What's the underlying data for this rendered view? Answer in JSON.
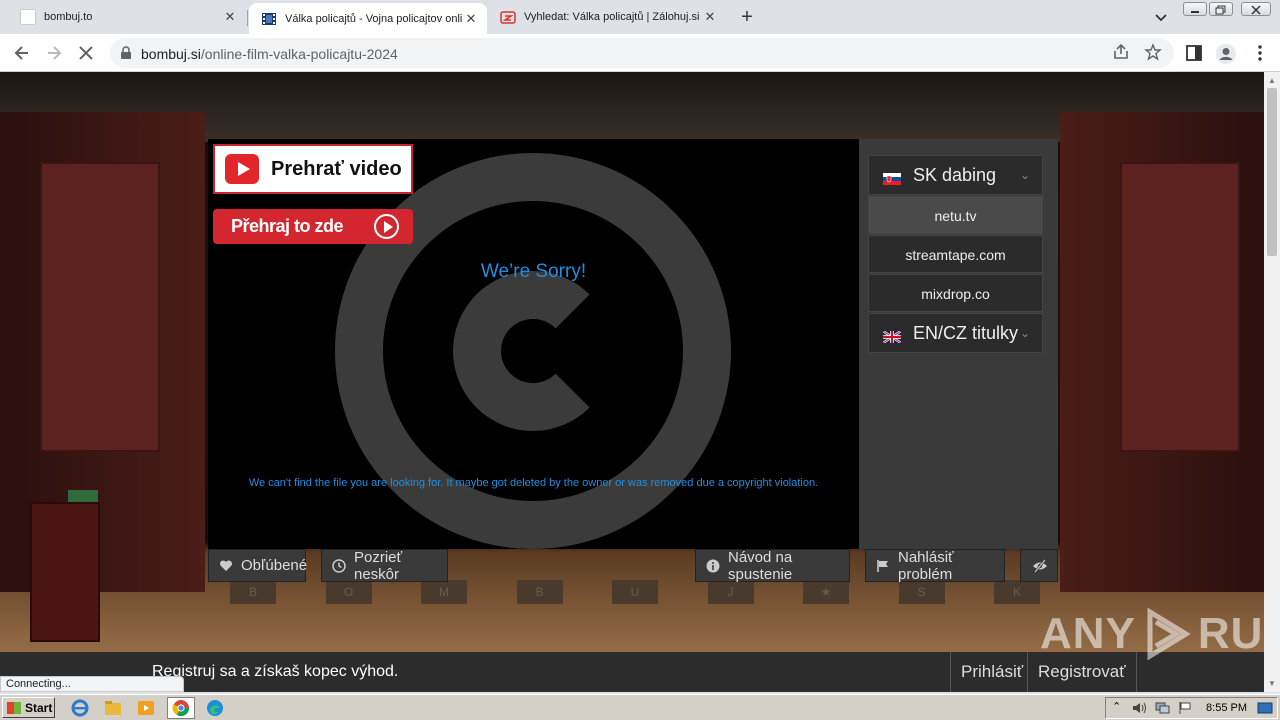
{
  "browser": {
    "tabs": [
      {
        "title": "bombuj.to",
        "active": false
      },
      {
        "title": "Válka policajtů - Vojna policajtov online",
        "active": true
      },
      {
        "title": "Vyhledat: Válka policajtů | Zálohuj.si",
        "active": false
      }
    ],
    "new_tab_label": "+",
    "url_host": "bombuj.si",
    "url_path": "/online-film-valka-policajtu-2024"
  },
  "player": {
    "play_button_label": "Prehrať video",
    "play_here_label": "Přehraj to zde",
    "sorry_title": "We’re Sorry!",
    "sorry_message": "We can't find the file you are looking for. It maybe got deleted by the owner or was removed due a copyright violation."
  },
  "sources": {
    "group_sk": "SK dabing",
    "items": [
      "netu.tv",
      "streamtape.com",
      "mixdrop.co"
    ],
    "group_en": "EN/CZ titulky"
  },
  "actions": {
    "favorite": "Obľúbené",
    "watch_later": "Pozrieť neskôr",
    "how_to_play": "Návod na spustenie",
    "report": "Nahlásiť problém"
  },
  "footer": {
    "promo": "Registruj sa a získaš kopec výhod.",
    "login": "Prihlásiť",
    "register": "Registrovať"
  },
  "stage_letters": [
    "B",
    "O",
    "M",
    "B",
    "U",
    "J",
    "★",
    "S",
    "K"
  ],
  "watermark": {
    "left": "ANY",
    "right": "RUN"
  },
  "status_text": "Connecting...",
  "taskbar": {
    "start_label": "Start",
    "clock": "8:55 PM"
  },
  "colors": {
    "accent_blue": "#1e8fe3",
    "brand_red": "#d3262f"
  }
}
